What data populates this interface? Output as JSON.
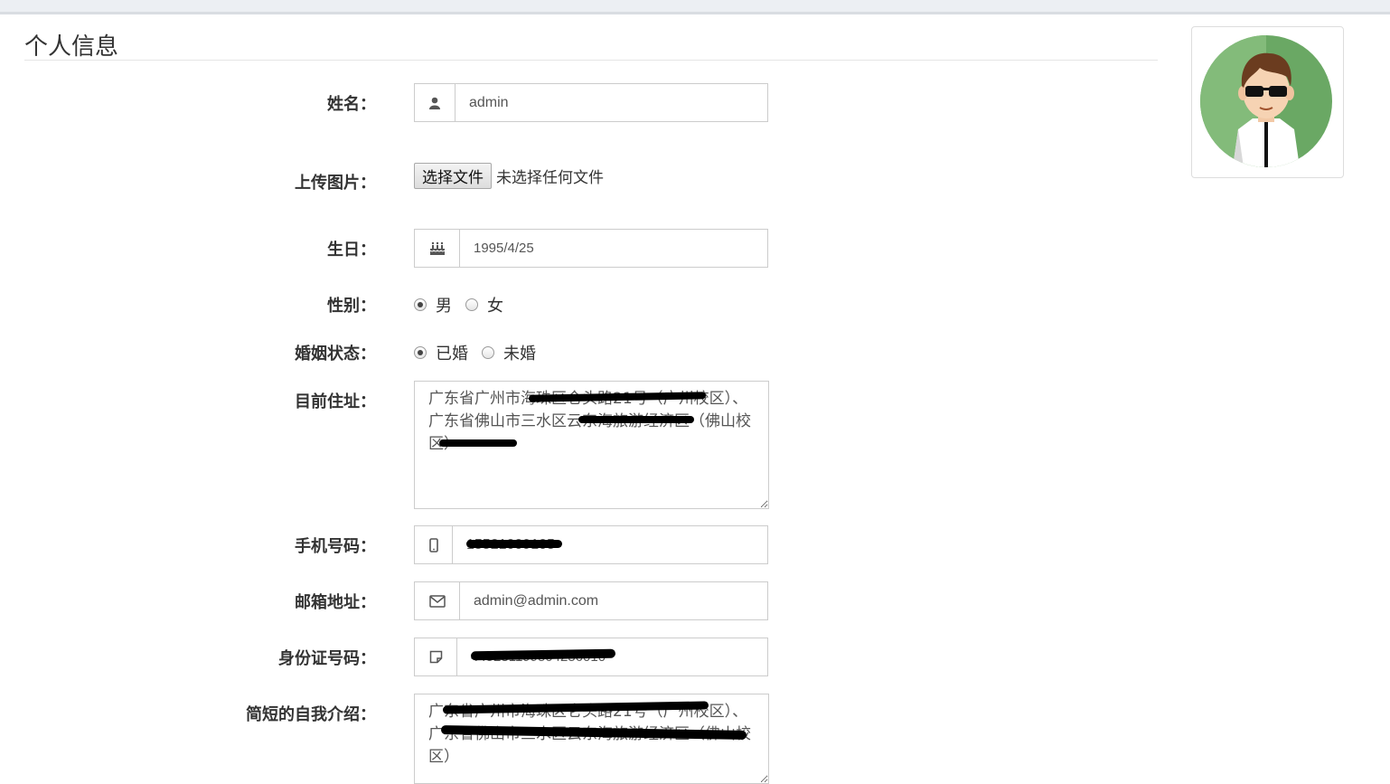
{
  "section": {
    "title": "个人信息"
  },
  "form": {
    "name": {
      "label": "姓名：",
      "value": "admin",
      "icon": "user-icon"
    },
    "upload": {
      "label": "上传图片：",
      "button": "选择文件",
      "status": "未选择任何文件"
    },
    "birthday": {
      "label": "生日：",
      "value": "1995/4/25",
      "icon": "birthday-cake-icon"
    },
    "gender": {
      "label": "性别：",
      "options": [
        "男",
        "女"
      ],
      "selected": "男"
    },
    "marital": {
      "label": "婚姻状态：",
      "options": [
        "已婚",
        "未婚"
      ],
      "selected": "已婚"
    },
    "address": {
      "label": "目前住址：",
      "value": "广东省广州市海珠区仑头路21号（广州校区）、广东省佛山市三水区云东海旅游经济区（佛山校区）"
    },
    "phone": {
      "label": "手机号码：",
      "value": "15521009105",
      "icon": "mobile-phone-icon"
    },
    "email": {
      "label": "邮箱地址：",
      "value": "admin@admin.com",
      "icon": "envelope-icon"
    },
    "idcard": {
      "label": "身份证号码：",
      "value": "445281199504256010",
      "icon": "id-card-icon"
    },
    "intro": {
      "label": "简短的自我介绍：",
      "value": "广东省广州市海珠区仑头路21号（广州校区）、广东省佛山市三水区云东海旅游经济区（佛山校区）"
    }
  },
  "avatar": {
    "icon": "user-avatar-image"
  }
}
